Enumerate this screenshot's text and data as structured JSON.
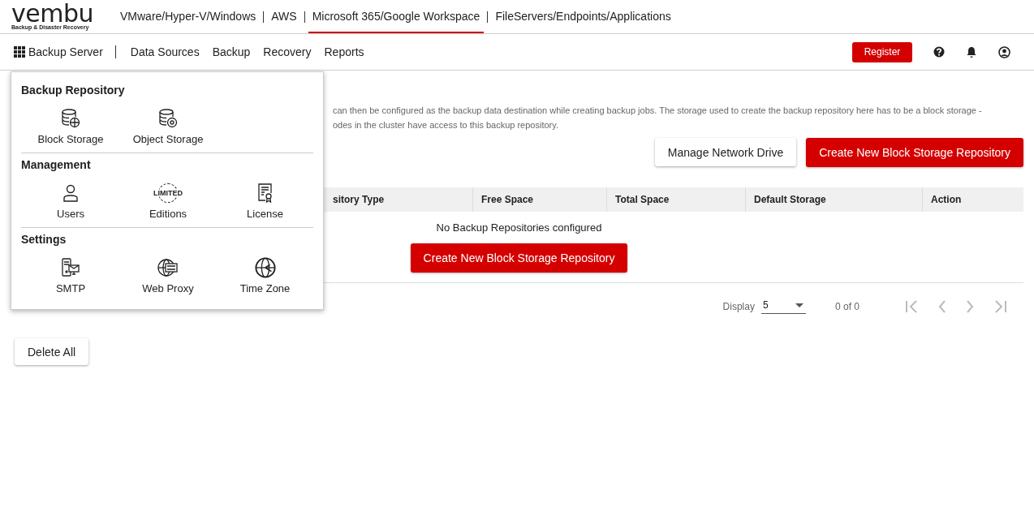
{
  "logo": {
    "name": "vembu",
    "tagline": "Backup & Disaster Recovery"
  },
  "product_tabs": [
    {
      "label": "VMware/Hyper-V/Windows",
      "selected": false
    },
    {
      "label": "AWS",
      "selected": false
    },
    {
      "label": "Microsoft 365/Google Workspace",
      "selected": true
    },
    {
      "label": "FileServers/Endpoints/Applications",
      "selected": false
    }
  ],
  "nav": {
    "server_menu": "Backup Server",
    "items": [
      "Data Sources",
      "Backup",
      "Recovery",
      "Reports"
    ],
    "register": "Register"
  },
  "description": [
    "can then be configured as the backup data destination while creating backup jobs. The storage used to create the backup repository here has to be a block storage -",
    "odes in the cluster have access to this backup repository."
  ],
  "actions": {
    "manage": "Manage Network Drive",
    "create": "Create New Block Storage Repository"
  },
  "table": {
    "columns": [
      "sitory Type",
      "Free Space",
      "Total Space",
      "Default Storage",
      "Action"
    ],
    "empty": "No Backup Repositories configured",
    "create": "Create New Block Storage Repository"
  },
  "pagination": {
    "display_label": "Display",
    "page_size": "5",
    "range": "0 of 0"
  },
  "delete_all": "Delete All",
  "menu": [
    {
      "title": "Backup Repository",
      "items": [
        {
          "label": "Block Storage",
          "kind": "block"
        },
        {
          "label": "Object Storage",
          "kind": "object"
        }
      ]
    },
    {
      "title": "Management",
      "items": [
        {
          "label": "Users",
          "kind": "user"
        },
        {
          "label": "Editions",
          "kind": "edition",
          "badge": "LIMITED"
        },
        {
          "label": "License",
          "kind": "license"
        }
      ]
    },
    {
      "title": "Settings",
      "items": [
        {
          "label": "SMTP",
          "kind": "smtp"
        },
        {
          "label": "Web Proxy",
          "kind": "proxy"
        },
        {
          "label": "Time Zone",
          "kind": "timezone"
        }
      ]
    }
  ]
}
